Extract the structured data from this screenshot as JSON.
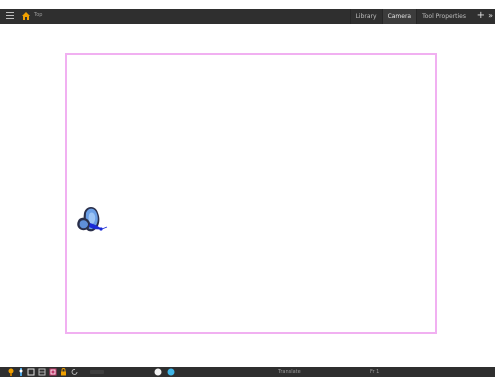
{
  "topbar": {
    "breadcrumb": "Top",
    "tabs": [
      {
        "label": "Library",
        "active": false
      },
      {
        "label": "Camera",
        "active": true
      },
      {
        "label": "Tool Properties",
        "active": false
      }
    ],
    "add_tab_glyph": "+",
    "more_glyph": "»"
  },
  "bottombar": {
    "tool_name": "Translate",
    "frame": "Fr 1"
  },
  "colors": {
    "chrome": "#2f2f2f",
    "camera_frame": "#f1b0f1",
    "accent_orange": "#f0a000",
    "butterfly_wing": "#6b9fe6",
    "butterfly_body": "#1a2bd6"
  },
  "icons": [
    "menu-icon",
    "home-icon",
    "butterfly-drawing",
    "light-bulb-icon",
    "transform-icon",
    "camera-icon",
    "frame-icon",
    "onion-skin-icon",
    "lock-icon",
    "rotate-icon",
    "zoom-icon",
    "color-swatch-icon"
  ]
}
